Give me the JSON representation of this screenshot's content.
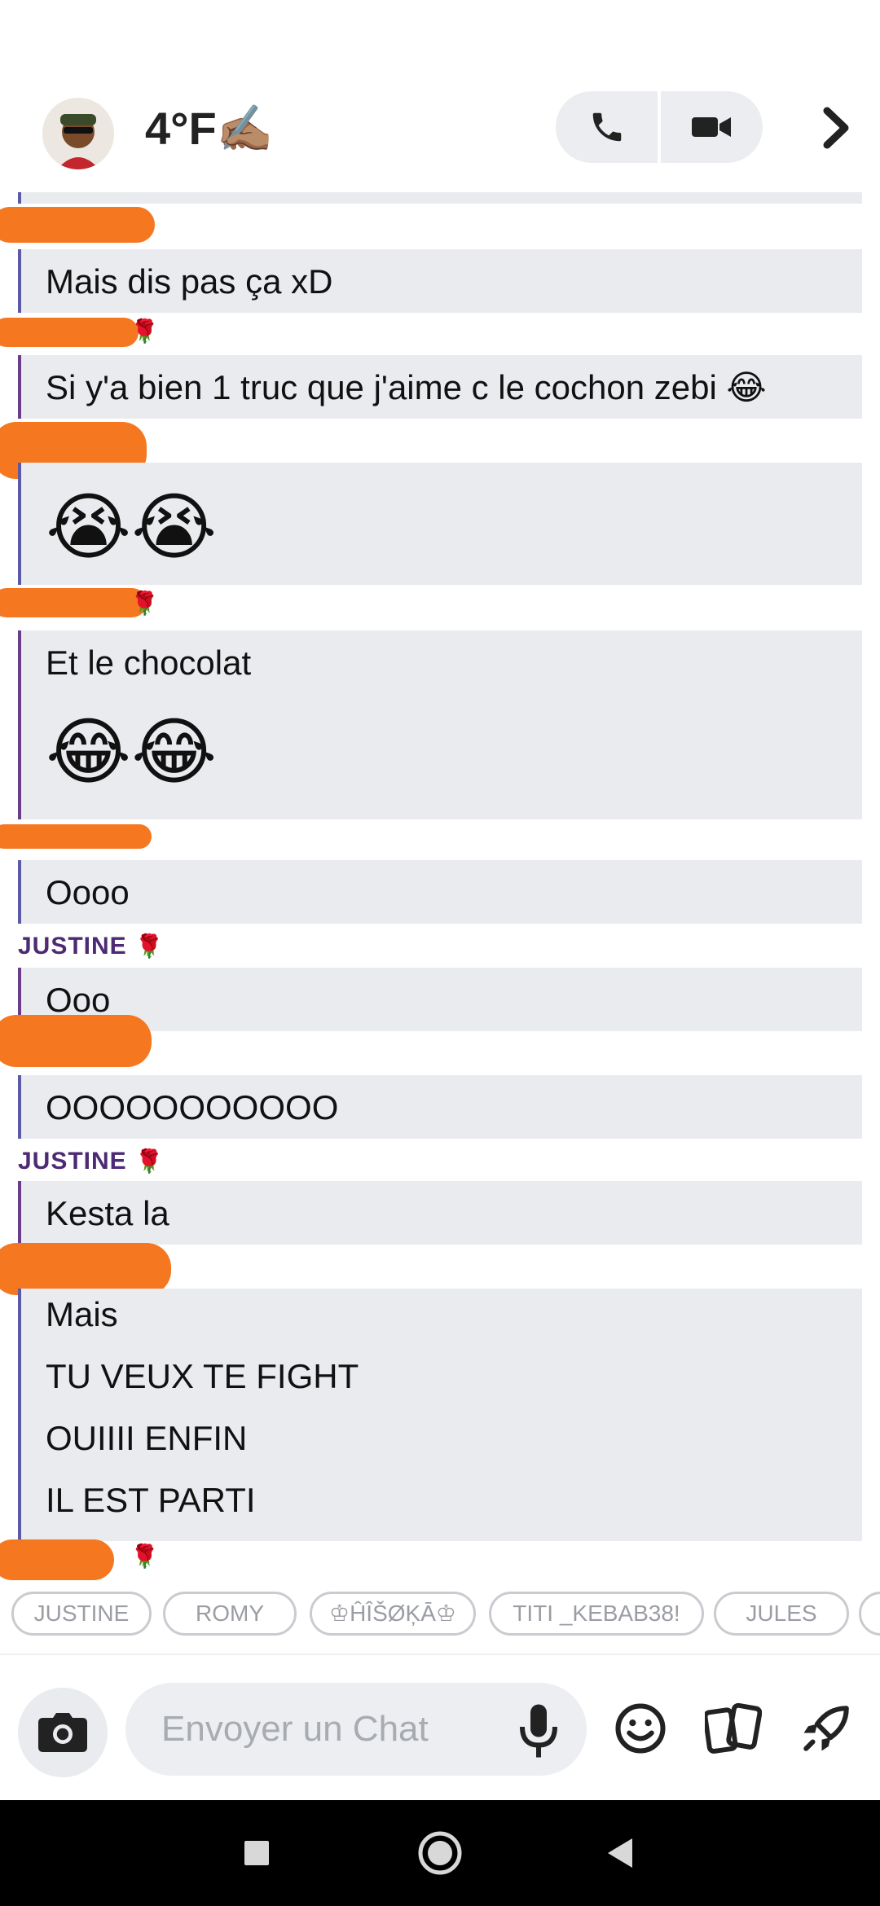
{
  "header": {
    "title": "4°F✍🏽",
    "avatar_icon": "bitmoji-avatar-icon",
    "call_icon": "phone-icon",
    "video_icon": "video-camera-icon",
    "chevron_icon": "chevron-right-icon"
  },
  "messages": [
    {
      "text": "Mais dis pas ça xD"
    },
    {
      "text": "Si y'a bien 1 truc que j'aime c le cochon zebi 😂"
    },
    {
      "text": "😭😭"
    },
    {
      "text": "Et le chocolat",
      "text2": "😂😂"
    },
    {
      "text": "Oooo"
    },
    {
      "text": "Ooo"
    },
    {
      "text": "OOOOOOOOOOO"
    },
    {
      "text": "Kesta la"
    },
    {
      "lines": [
        "Mais",
        "TU VEUX TE FIGHT",
        "OUIIII ENFIN",
        "IL EST PARTI"
      ]
    }
  ],
  "senders": {
    "justine": "JUSTINE",
    "rose": "🌹"
  },
  "chips": [
    "JUSTINE",
    "ROMY",
    "♔ĤÎŠØĶĀ♔",
    "TITI _KEBAB38!",
    "JULES"
  ],
  "composer": {
    "placeholder": "Envoyer un Chat",
    "camera_icon": "camera-icon",
    "mic_icon": "microphone-icon",
    "emoji_icon": "smiley-icon",
    "cards_icon": "cards-icon",
    "rocket_icon": "rocket-icon"
  },
  "navbar": {
    "recents_icon": "square-icon",
    "home_icon": "circle-icon",
    "back_icon": "triangle-back-icon"
  },
  "colors": {
    "bubble": "#e9ebef",
    "justine_bar": "#6a3c8a",
    "other_bar": "#5a5aa8",
    "justine_name": "#4d2a73",
    "scribble": "#f5771f"
  }
}
